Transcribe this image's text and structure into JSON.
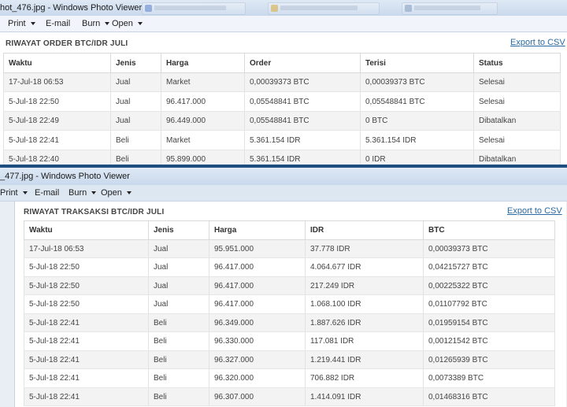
{
  "window1": {
    "title": "hot_476.jpg - Windows Photo Viewer",
    "menu": [
      "Print",
      "E-mail",
      "Burn",
      "Open"
    ],
    "heading": "RIWAYAT ORDER BTC/IDR JULI",
    "export_label": "Export to CSV",
    "columns": [
      "Waktu",
      "Jenis",
      "Harga",
      "Order",
      "Terisi",
      "Status"
    ],
    "rows": [
      [
        "17-Jul-18 06:53",
        "Jual",
        "Market",
        "0,00039373 BTC",
        "0,00039373 BTC",
        "Selesai"
      ],
      [
        "5-Jul-18 22:50",
        "Jual",
        "96.417.000",
        "0,05548841 BTC",
        "0,05548841 BTC",
        "Selesai"
      ],
      [
        "5-Jul-18 22:49",
        "Jual",
        "96.449.000",
        "0,05548841 BTC",
        "0 BTC",
        "Dibatalkan"
      ],
      [
        "5-Jul-18 22:41",
        "Beli",
        "Market",
        "5.361.154 IDR",
        "5.361.154 IDR",
        "Selesai"
      ],
      [
        "5-Jul-18 22:40",
        "Beli",
        "95.899.000",
        "5.361.154 IDR",
        "0 IDR",
        "Dibatalkan"
      ]
    ]
  },
  "window2": {
    "title": "_477.jpg - Windows Photo Viewer",
    "menu": [
      "Print",
      "E-mail",
      "Burn",
      "Open"
    ],
    "heading": "RIWAYAT TRAKSAKSI BTC/IDR JULI",
    "export_label": "Export to CSV",
    "columns": [
      "Waktu",
      "Jenis",
      "Harga",
      "IDR",
      "BTC"
    ],
    "rows": [
      [
        "17-Jul-18 06:53",
        "Jual",
        "95.951.000",
        "37.778 IDR",
        "0,00039373 BTC"
      ],
      [
        "5-Jul-18 22:50",
        "Jual",
        "96.417.000",
        "4.064.677 IDR",
        "0,04215727 BTC"
      ],
      [
        "5-Jul-18 22:50",
        "Jual",
        "96.417.000",
        "217.249 IDR",
        "0,00225322 BTC"
      ],
      [
        "5-Jul-18 22:50",
        "Jual",
        "96.417.000",
        "1.068.100 IDR",
        "0,01107792 BTC"
      ],
      [
        "5-Jul-18 22:41",
        "Beli",
        "96.349.000",
        "1.887.626 IDR",
        "0,01959154 BTC"
      ],
      [
        "5-Jul-18 22:41",
        "Beli",
        "96.330.000",
        "117.081 IDR",
        "0,00121542 BTC"
      ],
      [
        "5-Jul-18 22:41",
        "Beli",
        "96.327.000",
        "1.219.441 IDR",
        "0,01265939 BTC"
      ],
      [
        "5-Jul-18 22:41",
        "Beli",
        "96.320.000",
        "706.882 IDR",
        "0,0073389 BTC"
      ],
      [
        "5-Jul-18 22:41",
        "Beli",
        "96.307.000",
        "1.414.091 IDR",
        "0,01468316 BTC"
      ]
    ]
  },
  "colors": {
    "link": "#2a6aa0",
    "stripe": "#f3f3f3",
    "separator": "#1e4f80"
  }
}
